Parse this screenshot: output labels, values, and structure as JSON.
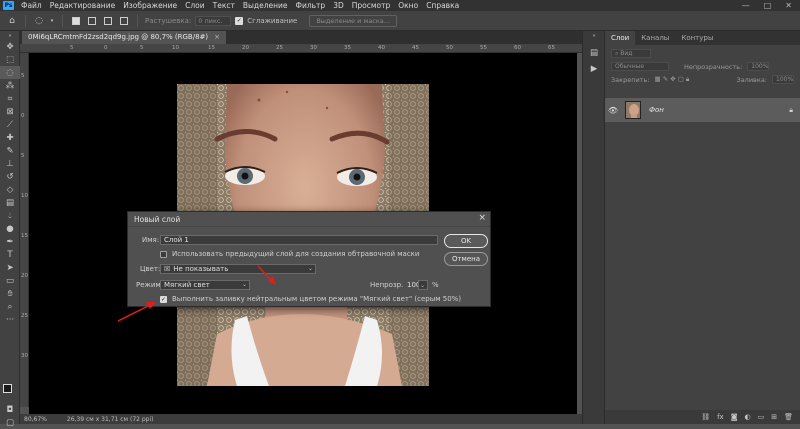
{
  "menu": {
    "app_icon": "Ps",
    "items": [
      "Файл",
      "Редактирование",
      "Изображение",
      "Слои",
      "Текст",
      "Выделение",
      "Фильтр",
      "3D",
      "Просмотр",
      "Окно",
      "Справка"
    ],
    "window_controls": [
      "—",
      "□",
      "✕"
    ]
  },
  "options": {
    "feather_label": "Растушевка:",
    "feather_value": "0 пикс.",
    "antialias_label": "Сглаживание",
    "select_mask_button": "Выделение и маска..."
  },
  "document": {
    "tab_title": "0Mi6qLRCmtmFd2zsd2qd9g.jpg @ 80,7% (RGB/8#)",
    "close": "×"
  },
  "ruler": {
    "h_ticks": [
      "5",
      "0",
      "5",
      "10",
      "15",
      "20",
      "25",
      "30",
      "35",
      "40",
      "45",
      "50",
      "55",
      "60",
      "65"
    ],
    "v_ticks": [
      "5",
      "0",
      "5",
      "10",
      "15",
      "20",
      "25",
      "30"
    ]
  },
  "status": {
    "zoom": "80,67%",
    "dimensions": "26,39 см x 31,71 см (72 ppi)"
  },
  "layers_panel": {
    "tabs": [
      "Слои",
      "Каналы",
      "Контуры"
    ],
    "active_tab": 0,
    "kind_label": "Вид",
    "blend_mode": "Обычные",
    "opacity_label": "Непрозрачность:",
    "opacity_value": "100%",
    "lock_label": "Закрепить:",
    "fill_label": "Заливка:",
    "fill_value": "100%",
    "layer_name": "Фон"
  },
  "dialog": {
    "title": "Новый слой",
    "name_label": "Имя:",
    "name_value": "Слой 1",
    "use_prev_label": "Использовать предыдущий слой для создания обтравочной маски",
    "use_prev_checked": false,
    "color_label": "Цвет:",
    "color_value": "Не показывать",
    "mode_label": "Режим:",
    "mode_value": "Мягкий свет",
    "opacity_label": "Непрозр.:",
    "opacity_value": "100",
    "opacity_unit": "%",
    "fill_neutral_label": "Выполнить заливку нейтральным цветом режима \"Мягкий свет\" (серым 50%)",
    "fill_neutral_checked": true,
    "ok_button": "OK",
    "cancel_button": "Отмена"
  },
  "colors": {
    "arrow": "#e11d1d",
    "app_blue": "#31a8ff",
    "panel_bg": "#424242",
    "canvas_bg": "#000000"
  }
}
